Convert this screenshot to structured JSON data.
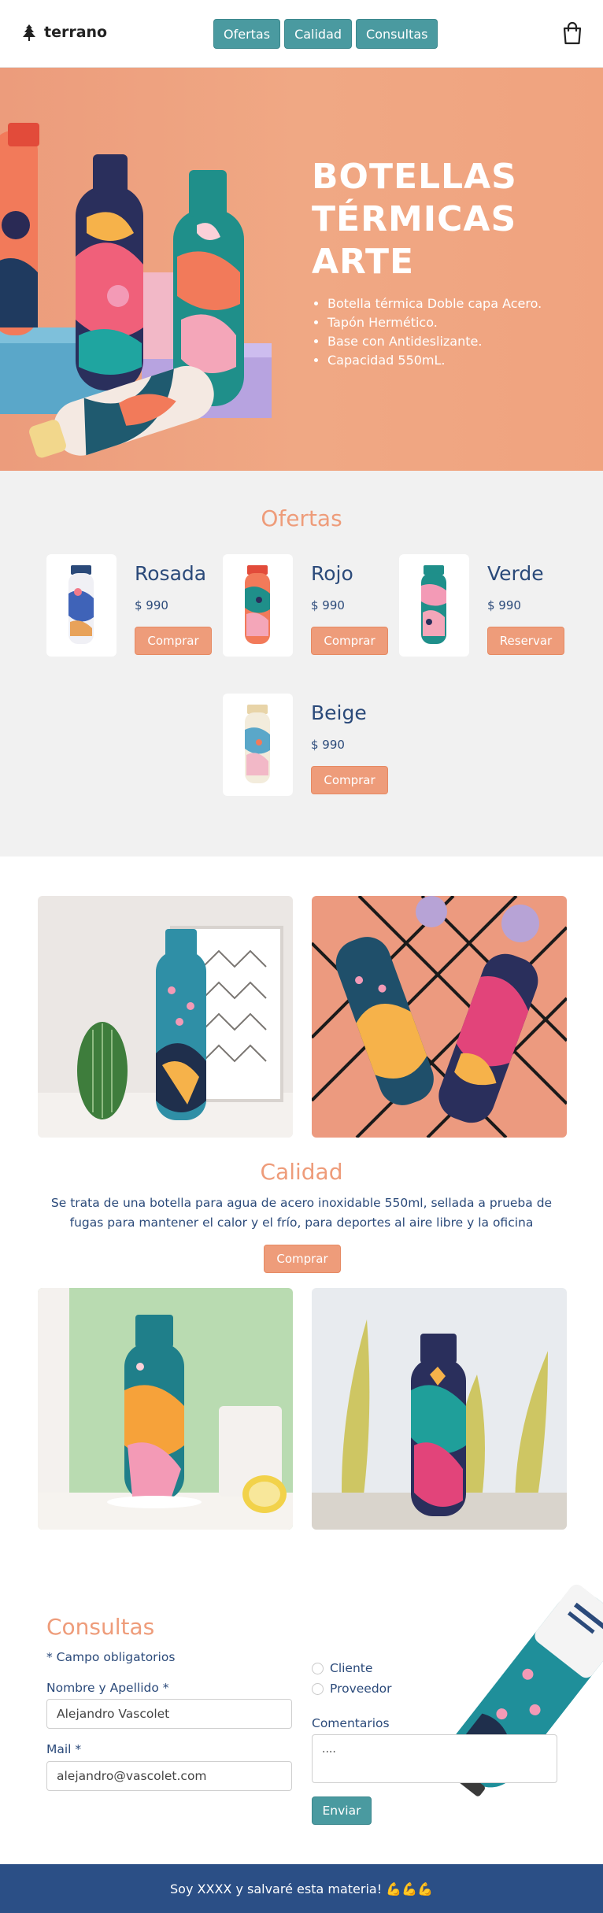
{
  "header": {
    "brand": "terrano",
    "nav": [
      "Ofertas",
      "Calidad",
      "Consultas"
    ]
  },
  "hero": {
    "title_lines": [
      "BOTELLAS",
      "TÉRMICAS",
      "ARTE"
    ],
    "features": [
      "Botella térmica Doble capa Acero.",
      "Tapón Hermético.",
      "Base con Antideslizante.",
      "Capacidad 550mL."
    ]
  },
  "ofertas": {
    "title": "Ofertas",
    "products": [
      {
        "name": "Rosada",
        "price": "$ 990",
        "button": "Comprar"
      },
      {
        "name": "Rojo",
        "price": "$ 990",
        "button": "Comprar"
      },
      {
        "name": "Verde",
        "price": "$ 990",
        "button": "Reservar"
      },
      {
        "name": "Beige",
        "price": "$ 990",
        "button": "Comprar"
      }
    ]
  },
  "calidad": {
    "title": "Calidad",
    "text": "Se trata de una botella para agua de acero inoxidable 550ml, sellada a prueba de fugas para mantener el calor y el frío, para deportes al aire libre y la oficina",
    "button": "Comprar"
  },
  "consultas": {
    "title": "Consultas",
    "required_note": "* Campo obligatorios",
    "name_label": "Nombre y Apellido *",
    "name_value": "Alejandro Vascolet",
    "mail_label": "Mail *",
    "mail_value": "alejandro@vascolet.com",
    "radio_options": [
      "Cliente",
      "Proveedor"
    ],
    "comments_label": "Comentarios",
    "comments_value": "....",
    "submit": "Enviar"
  },
  "footer": {
    "text": "Soy XXXX y salvaré esta materia! 💪💪💪"
  },
  "colors": {
    "teal": "#4a9aa0",
    "salmon": "#ee9c7a",
    "navy": "#2b4a7a",
    "footer": "#2b4f86"
  }
}
